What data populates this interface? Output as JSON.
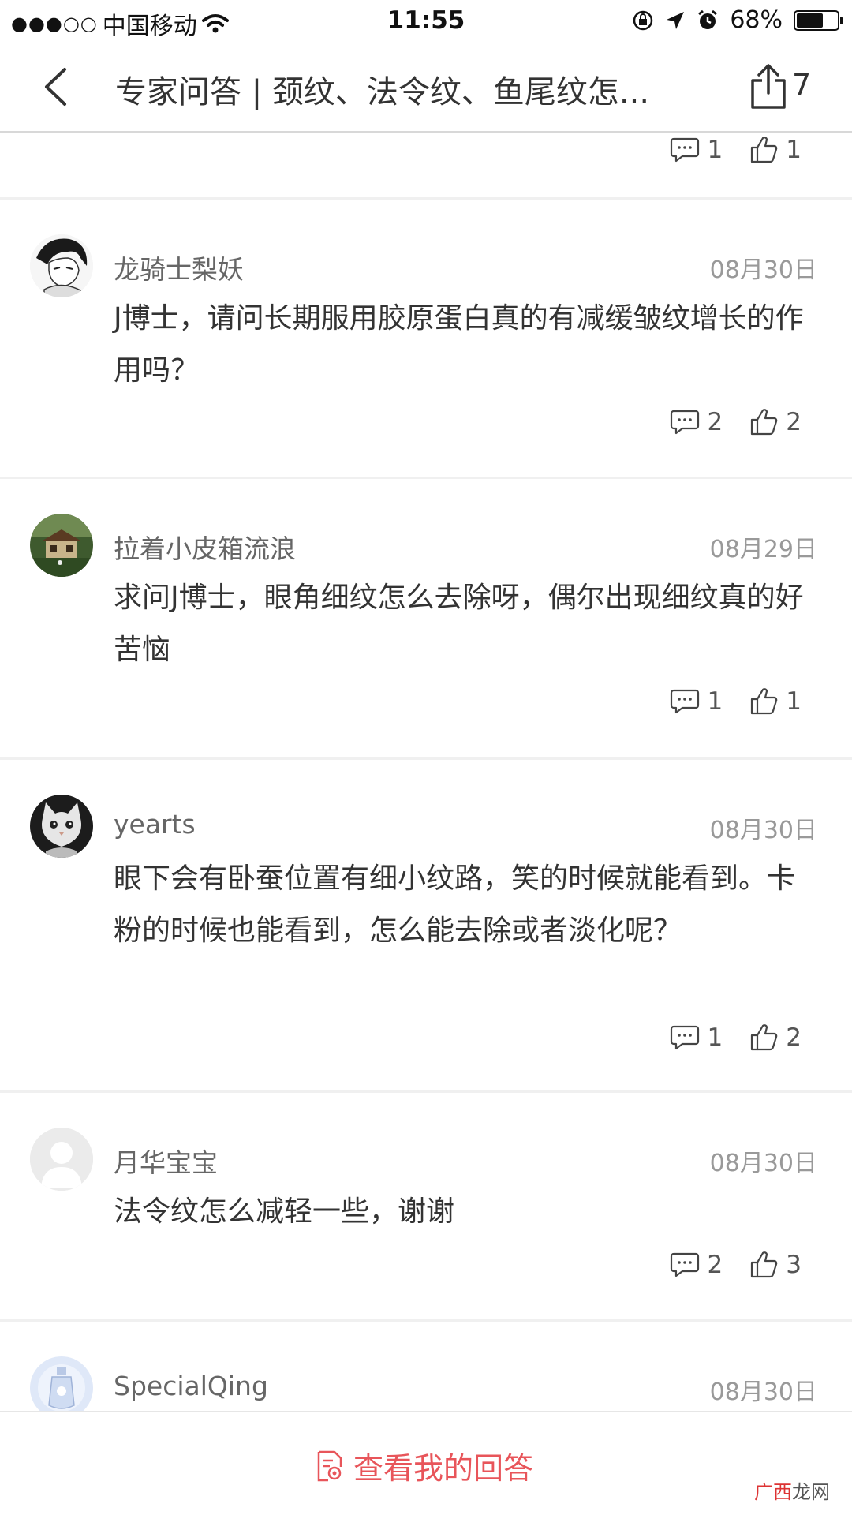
{
  "status_bar": {
    "carrier": "中国移动",
    "signal_dots": "●●●○○",
    "time": "11:55",
    "battery": "68%",
    "battery_level": 0.68
  },
  "nav": {
    "title": "专家问答 | 颈纹、法令纹、鱼尾纹怎...",
    "share_count": "7"
  },
  "top_actions": {
    "comments": "1",
    "likes": "1"
  },
  "comments": [
    {
      "username": "龙骑士梨妖",
      "date": "08月30日",
      "text": "J博士，请问长期服用胶原蛋白真的有减缓皱纹增长的作用吗？",
      "comment_count": "2",
      "like_count": "2",
      "avatar_icon": "manga-character-avatar"
    },
    {
      "username": "拉着小皮箱流浪",
      "date": "08月29日",
      "text": "求问J博士，眼角细纹怎么去除呀，偶尔出现细纹真的好苦恼",
      "comment_count": "1",
      "like_count": "1",
      "avatar_icon": "house-photo-avatar"
    },
    {
      "username": "yearts",
      "date": "08月30日",
      "text": "眼下会有卧蚕位置有细小纹路，笑的时候就能看到。卡粉的时候也能看到，怎么能去除或者淡化呢？",
      "comment_count": "1",
      "like_count": "2",
      "avatar_icon": "cat-photo-avatar"
    },
    {
      "username": "月华宝宝",
      "date": "08月30日",
      "text": "法令纹怎么减轻一些，谢谢",
      "comment_count": "2",
      "like_count": "3",
      "avatar_icon": "default-avatar"
    },
    {
      "username": "SpecialQing",
      "date": "08月30日",
      "text": "",
      "avatar_icon": "glass-bottle-avatar"
    }
  ],
  "bottom": {
    "view_my_answers": "查看我的回答",
    "watermark_red": "广西",
    "watermark_black": "龙网"
  },
  "colors": {
    "accent": "#e8555a",
    "text": "#333333",
    "muted": "#999999"
  }
}
